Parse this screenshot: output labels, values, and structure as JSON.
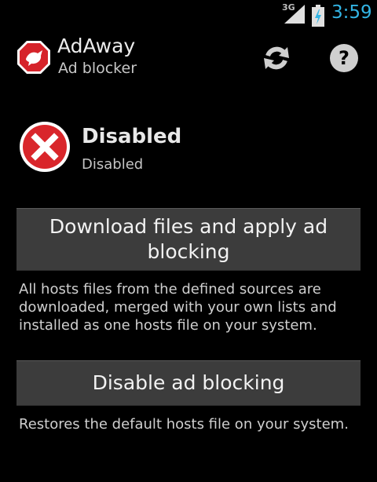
{
  "status_bar": {
    "network_type": "3G",
    "time": "3:59",
    "signal_icon": "signal-icon",
    "battery_icon": "battery-charging-icon",
    "clock_color": "#33b5e5"
  },
  "action_bar": {
    "title": "AdAway",
    "subtitle": "Ad blocker",
    "app_icon": "adaway-logo-icon",
    "actions": [
      {
        "icon": "refresh-icon"
      },
      {
        "icon": "help-icon"
      }
    ]
  },
  "status": {
    "icon": "disabled-x-icon",
    "title": "Disabled",
    "subtitle": "Disabled",
    "icon_color": "#d9262b"
  },
  "download": {
    "button_label": "Download files and apply ad blocking",
    "description": "All hosts files from the defined sources are downloaded, merged with your own lists and installed as one hosts file on your system."
  },
  "disable": {
    "button_label": "Disable ad blocking",
    "description": "Restores the default hosts file on your system."
  }
}
